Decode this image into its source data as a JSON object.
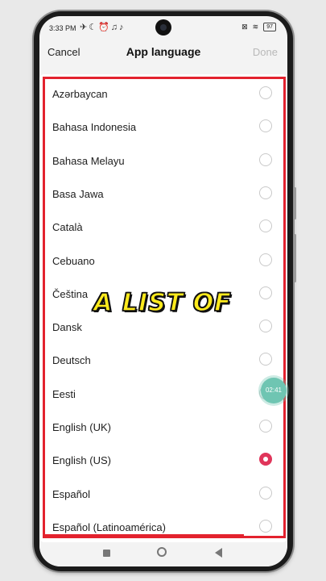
{
  "status": {
    "time": "3:33 PM",
    "battery": "97"
  },
  "header": {
    "cancel": "Cancel",
    "title": "App language",
    "done": "Done"
  },
  "languages": [
    {
      "label": "Azərbaycan",
      "selected": false
    },
    {
      "label": "Bahasa Indonesia",
      "selected": false
    },
    {
      "label": "Bahasa Melayu",
      "selected": false
    },
    {
      "label": "Basa Jawa",
      "selected": false
    },
    {
      "label": "Català",
      "selected": false
    },
    {
      "label": "Cebuano",
      "selected": false
    },
    {
      "label": "Čeština",
      "selected": false
    },
    {
      "label": "Dansk",
      "selected": false
    },
    {
      "label": "Deutsch",
      "selected": false
    },
    {
      "label": "Eesti",
      "selected": false
    },
    {
      "label": "English (UK)",
      "selected": false
    },
    {
      "label": "English (US)",
      "selected": true
    },
    {
      "label": "Español",
      "selected": false
    },
    {
      "label": "Español (Latinoamérica)",
      "selected": false
    }
  ],
  "overlay": {
    "caption": "A LIST OF",
    "timer": "02:41"
  },
  "colors": {
    "accent": "#e0355a",
    "highlight_frame": "#e3222e",
    "caption": "#ffeb1c"
  }
}
